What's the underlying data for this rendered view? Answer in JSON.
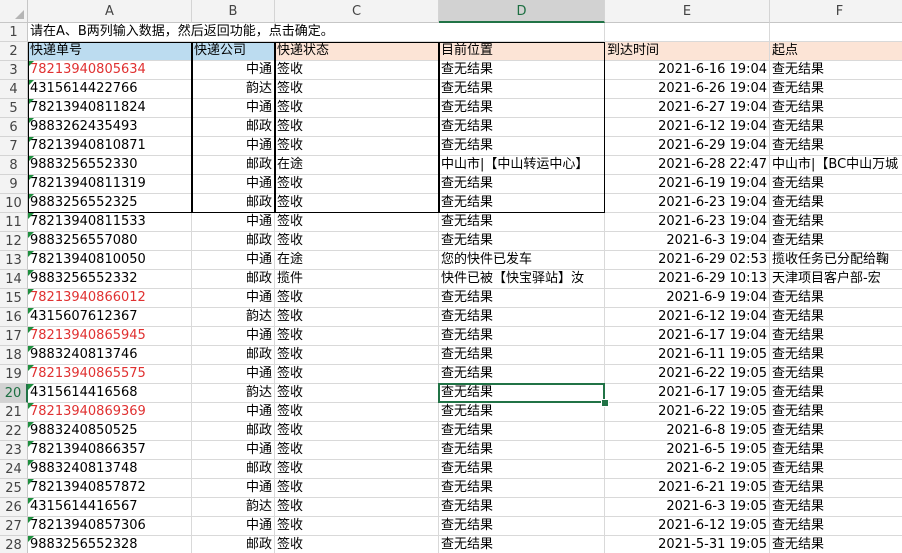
{
  "columns": [
    "A",
    "B",
    "C",
    "D",
    "E",
    "F"
  ],
  "selected_cell": {
    "column": "D",
    "row": 20
  },
  "title_row": "请在A、B两列输入数据，然后返回功能，点击确定。",
  "headers": [
    "快递单号",
    "快递公司",
    "快递状态",
    "目前位置",
    "到达时间",
    "起点"
  ],
  "rows": [
    {
      "n": "3",
      "a": "78213940805634",
      "b": "中通",
      "c": "签收",
      "d": "查无结果",
      "e": "2021-6-16 19:04",
      "f": "查无结果",
      "red": true
    },
    {
      "n": "4",
      "a": "4315614422766",
      "b": "韵达",
      "c": "签收",
      "d": "查无结果",
      "e": "2021-6-26 19:04",
      "f": "查无结果",
      "red": false
    },
    {
      "n": "5",
      "a": "78213940811824",
      "b": "中通",
      "c": "签收",
      "d": "查无结果",
      "e": "2021-6-27 19:04",
      "f": "查无结果",
      "red": false
    },
    {
      "n": "6",
      "a": "9883262435493",
      "b": "邮政",
      "c": "签收",
      "d": "查无结果",
      "e": "2021-6-12 19:04",
      "f": "查无结果",
      "red": false
    },
    {
      "n": "7",
      "a": "78213940810871",
      "b": "中通",
      "c": "签收",
      "d": "查无结果",
      "e": "2021-6-29 19:04",
      "f": "查无结果",
      "red": false
    },
    {
      "n": "8",
      "a": "9883256552330",
      "b": "邮政",
      "c": "在途",
      "d": "中山市|【中山转运中心】",
      "e": "2021-6-28 22:47",
      "f": "中山市|【BC中山万城",
      "red": false
    },
    {
      "n": "9",
      "a": "78213940811319",
      "b": "中通",
      "c": "签收",
      "d": "查无结果",
      "e": "2021-6-19 19:04",
      "f": "查无结果",
      "red": false
    },
    {
      "n": "10",
      "a": "9883256552325",
      "b": "邮政",
      "c": "签收",
      "d": "查无结果",
      "e": "2021-6-23 19:04",
      "f": "查无结果",
      "red": false
    },
    {
      "n": "11",
      "a": "78213940811533",
      "b": "中通",
      "c": "签收",
      "d": "查无结果",
      "e": "2021-6-23 19:04",
      "f": "查无结果",
      "red": false
    },
    {
      "n": "12",
      "a": "9883256557080",
      "b": "邮政",
      "c": "签收",
      "d": "查无结果",
      "e": "2021-6-3 19:04",
      "f": "查无结果",
      "red": false
    },
    {
      "n": "13",
      "a": "78213940810050",
      "b": "中通",
      "c": "在途",
      "d": "您的快件已发车",
      "e": "2021-6-29 02:53",
      "f": "揽收任务已分配给鞠",
      "red": false
    },
    {
      "n": "14",
      "a": "9883256552332",
      "b": "邮政",
      "c": "揽件",
      "d": "快件已被【快宝驿站】汝",
      "e": "2021-6-29 10:13",
      "f": "天津项目客户部-宏",
      "red": false
    },
    {
      "n": "15",
      "a": "78213940866012",
      "b": "中通",
      "c": "签收",
      "d": "查无结果",
      "e": "2021-6-9 19:04",
      "f": "查无结果",
      "red": true
    },
    {
      "n": "16",
      "a": "4315607612367",
      "b": "韵达",
      "c": "签收",
      "d": "查无结果",
      "e": "2021-6-12 19:04",
      "f": "查无结果",
      "red": false
    },
    {
      "n": "17",
      "a": "78213940865945",
      "b": "中通",
      "c": "签收",
      "d": "查无结果",
      "e": "2021-6-17 19:04",
      "f": "查无结果",
      "red": true
    },
    {
      "n": "18",
      "a": "9883240813746",
      "b": "邮政",
      "c": "签收",
      "d": "查无结果",
      "e": "2021-6-11 19:05",
      "f": "查无结果",
      "red": false
    },
    {
      "n": "19",
      "a": "78213940865575",
      "b": "中通",
      "c": "签收",
      "d": "查无结果",
      "e": "2021-6-22 19:05",
      "f": "查无结果",
      "red": true
    },
    {
      "n": "20",
      "a": "4315614416568",
      "b": "韵达",
      "c": "签收",
      "d": "查无结果",
      "e": "2021-6-17 19:05",
      "f": "查无结果",
      "red": false
    },
    {
      "n": "21",
      "a": "78213940869369",
      "b": "中通",
      "c": "签收",
      "d": "查无结果",
      "e": "2021-6-22 19:05",
      "f": "查无结果",
      "red": true
    },
    {
      "n": "22",
      "a": "9883240850525",
      "b": "邮政",
      "c": "签收",
      "d": "查无结果",
      "e": "2021-6-8 19:05",
      "f": "查无结果",
      "red": false
    },
    {
      "n": "23",
      "a": "78213940866357",
      "b": "中通",
      "c": "签收",
      "d": "查无结果",
      "e": "2021-6-5 19:05",
      "f": "查无结果",
      "red": false
    },
    {
      "n": "24",
      "a": "9883240813748",
      "b": "邮政",
      "c": "签收",
      "d": "查无结果",
      "e": "2021-6-2 19:05",
      "f": "查无结果",
      "red": false
    },
    {
      "n": "25",
      "a": "78213940857872",
      "b": "中通",
      "c": "签收",
      "d": "查无结果",
      "e": "2021-6-21 19:05",
      "f": "查无结果",
      "red": false
    },
    {
      "n": "26",
      "a": "4315614416567",
      "b": "韵达",
      "c": "签收",
      "d": "查无结果",
      "e": "2021-6-3 19:05",
      "f": "查无结果",
      "red": false
    },
    {
      "n": "27",
      "a": "78213940857306",
      "b": "中通",
      "c": "签收",
      "d": "查无结果",
      "e": "2021-6-12 19:05",
      "f": "查无结果",
      "red": false
    },
    {
      "n": "28",
      "a": "9883256552328",
      "b": "邮政",
      "c": "签收",
      "d": "查无结果",
      "e": "2021-5-31 19:05",
      "f": "查无结果",
      "red": false
    }
  ],
  "colors": {
    "accent": "#217346",
    "red_text": "#e03131",
    "header_blue": "#bcdcf0",
    "header_peach": "#fce4d6"
  }
}
